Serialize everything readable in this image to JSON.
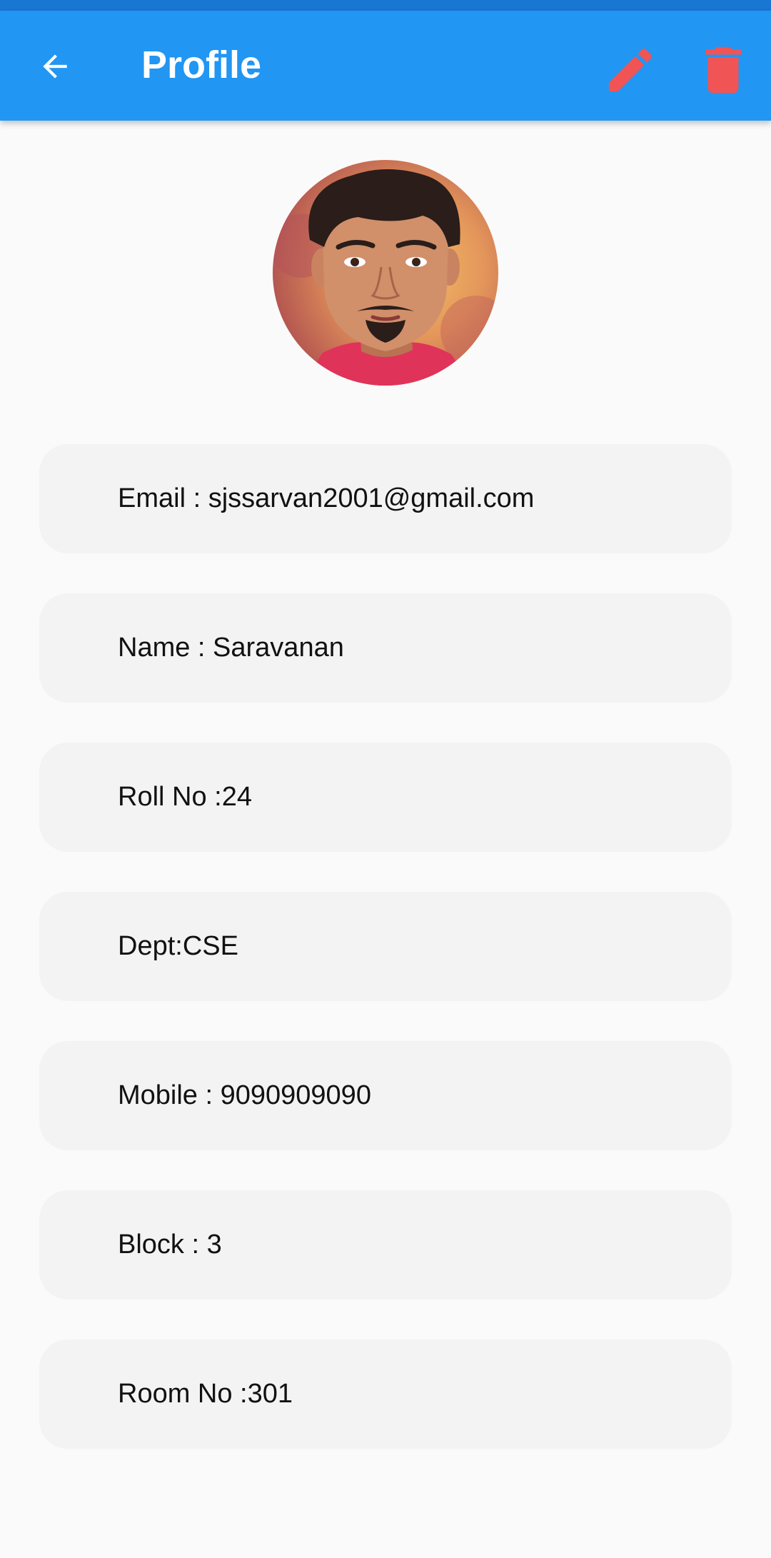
{
  "app_bar": {
    "title": "Profile",
    "back_icon": "arrow-back-icon",
    "edit_icon": "pencil-icon",
    "delete_icon": "trash-icon",
    "background_color": "#2196F3",
    "action_icon_color": "#F05454"
  },
  "profile": {
    "avatar_icon": "cartoon-avatar",
    "fields": [
      {
        "label": "Email : sjssarvan2001@gmail.com"
      },
      {
        "label": "Name : Saravanan"
      },
      {
        "label": "Roll No :24"
      },
      {
        "label": "Dept:CSE"
      },
      {
        "label": "Mobile : 9090909090"
      },
      {
        "label": "Block : 3"
      },
      {
        "label": "Room No :301"
      }
    ]
  }
}
